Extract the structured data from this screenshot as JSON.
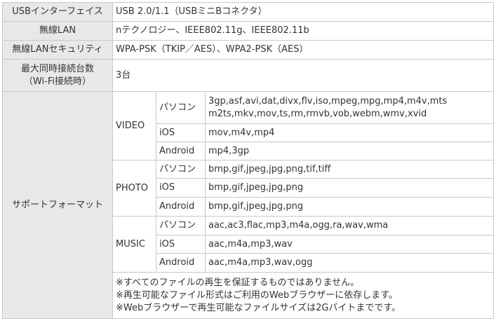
{
  "rows": {
    "usb": {
      "label": "USBインターフェイス",
      "value": "USB 2.0/1.1（USBミニBコネクタ）"
    },
    "wlan": {
      "label": "無線LAN",
      "value": "nテクノロジー、IEEE802.11g、IEEE802.11b"
    },
    "security": {
      "label": "無線LANセキュリティ",
      "value": "WPA-PSK（TKIP／AES）、WPA2-PSK（AES）"
    },
    "max_conn": {
      "label_line1": "最大同時接続台数",
      "label_line2": "（Wi-Fi接続時）",
      "value": "3台"
    },
    "formats": {
      "label": "サポートフォーマット",
      "video": {
        "label": "VIDEO",
        "pc_label": "パソコン",
        "pc_line1": "3gp,asf,avi,dat,divx,flv,iso,mpeg,mpg,mp4,m4v,mts",
        "pc_line2": "m2ts,mkv,mov,ts,rm,rmvb,vob,webm,wmv,xvid",
        "ios_label": "iOS",
        "ios": "mov,m4v,mp4",
        "android_label": "Android",
        "android": "mp4,3gp"
      },
      "photo": {
        "label": "PHOTO",
        "pc_label": "パソコン",
        "pc": "bmp,gif,jpeg,jpg,png,tif,tiff",
        "ios_label": "iOS",
        "ios": "bmp,gif,jpeg,jpg,png",
        "android_label": "Android",
        "android": "bmp,gif,jpeg,jpg,png"
      },
      "music": {
        "label": "MUSIC",
        "pc_label": "パソコン",
        "pc": "aac,ac3,flac,mp3,m4a,ogg,ra,wav,wma",
        "ios_label": "iOS",
        "ios": "aac,m4a,mp3,wav",
        "android_label": "Android",
        "android": "aac,m4a,mp3,wav,ogg"
      },
      "notes": [
        "※すべてのファイルの再生を保証するものではありません。",
        "※再生可能なファイル形式はご利用のWebブラウザーに依存します。",
        "※Webブラウザーで再生可能なファイルサイズは2Gバイトまでです。"
      ]
    }
  }
}
